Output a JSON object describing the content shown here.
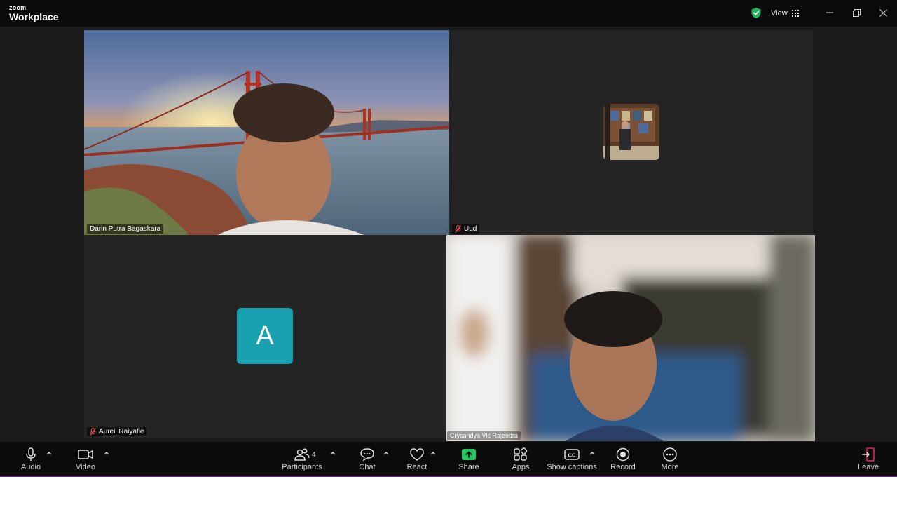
{
  "titlebar": {
    "brand_small": "zoom",
    "brand_big": "Workplace",
    "view_label": "View"
  },
  "participants": [
    {
      "name": "Darin Putra Bagaskara",
      "muted": false,
      "active": true
    },
    {
      "name": "Uud",
      "muted": true,
      "active": false
    },
    {
      "name": "Aureil Raiyafie",
      "muted": true,
      "active": false,
      "avatar_letter": "A"
    },
    {
      "name": "Crysandya Vic Rajendra",
      "muted": false,
      "active": false
    }
  ],
  "toolbar": {
    "audio": "Audio",
    "video": "Video",
    "participants": "Participants",
    "participants_count": "4",
    "chat": "Chat",
    "react": "React",
    "share": "Share",
    "apps": "Apps",
    "captions": "Show captions",
    "record": "Record",
    "more": "More",
    "leave": "Leave"
  },
  "colors": {
    "active_border": "#3ee08a",
    "share_green": "#22c55e",
    "avatar_teal": "#1aa1b0",
    "leave_red": "#e0245e"
  }
}
